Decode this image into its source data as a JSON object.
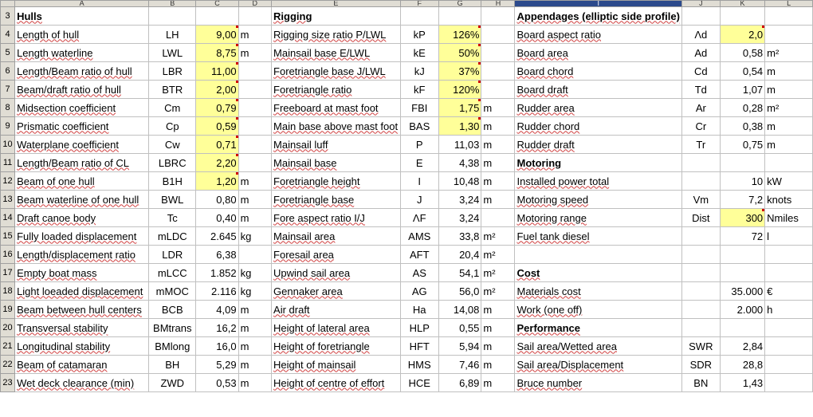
{
  "columns": [
    "A",
    "B",
    "C",
    "D",
    "E",
    "F",
    "G",
    "H",
    "I",
    "J",
    "K",
    "L"
  ],
  "selected_column": "I",
  "rows": [
    {
      "n": "3",
      "a": "Hulls",
      "ab": true,
      "b": "",
      "c": "",
      "cy": false,
      "d": "",
      "e": "Rigging",
      "eb": true,
      "f": "",
      "g": "",
      "gy": false,
      "h": "",
      "i": "Appendages (elliptic side profile)",
      "ib": true,
      "j": "",
      "k": "",
      "ky": false,
      "l": ""
    },
    {
      "n": "4",
      "a": "Length of hull",
      "b": "LH",
      "c": "9,00",
      "cy": true,
      "d": "m",
      "e": "Rigging size ratio P/LWL",
      "f": "kP",
      "g": "126%",
      "gy": true,
      "h": "",
      "i": "Board aspect ratio",
      "j": "Λd",
      "k": "2,0",
      "ky": true,
      "l": ""
    },
    {
      "n": "5",
      "a": "Length waterline",
      "b": "LWL",
      "c": "8,75",
      "cy": true,
      "d": "m",
      "e": "Mainsail base E/LWL",
      "f": "kE",
      "g": "50%",
      "gy": true,
      "h": "",
      "i": "Board area",
      "j": "Ad",
      "k": "0,58",
      "ky": false,
      "l": "m²"
    },
    {
      "n": "6",
      "a": "Length/Beam ratio of hull",
      "b": "LBR",
      "c": "11,00",
      "cy": true,
      "d": "",
      "e": "Foretriangle base J/LWL",
      "f": "kJ",
      "g": "37%",
      "gy": true,
      "h": "",
      "i": "Board chord",
      "j": "Cd",
      "k": "0,54",
      "ky": false,
      "l": "m"
    },
    {
      "n": "7",
      "a": "Beam/draft ratio of hull",
      "b": "BTR",
      "c": "2,00",
      "cy": true,
      "d": "",
      "e": "Foretriangle ratio",
      "f": "kF",
      "g": "120%",
      "gy": true,
      "h": "",
      "i": "Board draft",
      "j": "Td",
      "k": "1,07",
      "ky": false,
      "l": "m"
    },
    {
      "n": "8",
      "a": "Midsection coefficient",
      "b": "Cm",
      "c": "0,79",
      "cy": true,
      "d": "",
      "e": "Freeboard at mast foot",
      "f": "FBI",
      "g": "1,75",
      "gy": true,
      "h": "m",
      "i": "Rudder area",
      "j": "Ar",
      "k": "0,28",
      "ky": false,
      "l": "m²"
    },
    {
      "n": "9",
      "a": "Prismatic coefficient",
      "b": "Cp",
      "c": "0,59",
      "cy": true,
      "d": "",
      "e": "Main base above mast foot",
      "f": "BAS",
      "g": "1,30",
      "gy": true,
      "h": "m",
      "i": "Rudder chord",
      "j": "Cr",
      "k": "0,38",
      "ky": false,
      "l": "m"
    },
    {
      "n": "10",
      "a": "Waterplane coefficient",
      "b": "Cw",
      "c": "0,71",
      "cy": true,
      "d": "",
      "e": "Mainsail luff",
      "f": "P",
      "g": "11,03",
      "gy": false,
      "h": "m",
      "i": "Rudder draft",
      "j": "Tr",
      "k": "0,75",
      "ky": false,
      "l": "m"
    },
    {
      "n": "11",
      "a": "Length/Beam ratio of CL",
      "b": "LBRC",
      "c": "2,20",
      "cy": true,
      "d": "",
      "e": "Mainsail base",
      "f": "E",
      "g": "4,38",
      "gy": false,
      "h": "m",
      "i": "Motoring",
      "ib": true,
      "j": "",
      "k": "",
      "ky": false,
      "l": ""
    },
    {
      "n": "12",
      "a": "Beam of one hull",
      "b": "B1H",
      "c": "1,20",
      "cy": true,
      "d": "m",
      "e": "Foretriangle height",
      "f": "I",
      "g": "10,48",
      "gy": false,
      "h": "m",
      "i": "Installed power total",
      "j": "",
      "k": "10",
      "ky": false,
      "l": "kW"
    },
    {
      "n": "13",
      "a": "Beam waterline of one hull",
      "b": "BWL",
      "c": "0,80",
      "cy": false,
      "d": "m",
      "e": "Foretriangle base",
      "f": "J",
      "g": "3,24",
      "gy": false,
      "h": "m",
      "i": "Motoring speed",
      "j": "Vm",
      "k": "7,2",
      "ky": false,
      "l": "knots"
    },
    {
      "n": "14",
      "a": "Draft canoe body",
      "b": "Tc",
      "c": "0,40",
      "cy": false,
      "d": "m",
      "e": "Fore aspect ratio I/J",
      "f": "ΛF",
      "g": "3,24",
      "gy": false,
      "h": "",
      "i": "Motoring range",
      "j": "Dist",
      "k": "300",
      "ky": true,
      "l": "Nmiles"
    },
    {
      "n": "15",
      "a": "Fully loaded displacement",
      "b": "mLDC",
      "c": "2.645",
      "cy": false,
      "d": "kg",
      "e": "Mainsail area",
      "f": "AMS",
      "g": "33,8",
      "gy": false,
      "h": "m²",
      "i": "Fuel tank diesel",
      "j": "",
      "k": "72",
      "ky": false,
      "l": "l"
    },
    {
      "n": "16",
      "a": "Length/displacement ratio",
      "b": "LDR",
      "c": "6,38",
      "cy": false,
      "d": "",
      "e": "Foresail area",
      "f": "AFT",
      "g": "20,4",
      "gy": false,
      "h": "m²",
      "i": "",
      "j": "",
      "k": "",
      "ky": false,
      "l": ""
    },
    {
      "n": "17",
      "a": "Empty boat mass",
      "b": "mLCC",
      "c": "1.852",
      "cy": false,
      "d": "kg",
      "e": "Upwind sail area",
      "f": "AS",
      "g": "54,1",
      "gy": false,
      "h": "m²",
      "i": "Cost",
      "ib": true,
      "j": "",
      "k": "",
      "ky": false,
      "l": ""
    },
    {
      "n": "18",
      "a": "Light loeaded displacement",
      "b": "mMOC",
      "c": "2.116",
      "cy": false,
      "d": "kg",
      "e": "Gennaker area",
      "f": "AG",
      "g": "56,0",
      "gy": false,
      "h": "m²",
      "i": "Materials cost",
      "j": "",
      "k": "35.000",
      "ky": false,
      "l": "€"
    },
    {
      "n": "19",
      "a": "Beam between hull centers",
      "b": "BCB",
      "c": "4,09",
      "cy": false,
      "d": "m",
      "e": "Air draft",
      "f": "Ha",
      "g": "14,08",
      "gy": false,
      "h": "m",
      "i": "Work (one off)",
      "j": "",
      "k": "2.000",
      "ky": false,
      "l": "h"
    },
    {
      "n": "20",
      "a": "Transversal stability",
      "b": "BMtrans",
      "c": "16,2",
      "cy": false,
      "d": "m",
      "e": "Height of lateral area",
      "f": "HLP",
      "g": "0,55",
      "gy": false,
      "h": "m",
      "i": "Performance",
      "ib": true,
      "j": "",
      "k": "",
      "ky": false,
      "l": ""
    },
    {
      "n": "21",
      "a": "Longitudinal stability",
      "b": "BMlong",
      "c": "16,0",
      "cy": false,
      "d": "m",
      "e": "Height of foretriangle",
      "f": "HFT",
      "g": "5,94",
      "gy": false,
      "h": "m",
      "i": "Sail area/Wetted area",
      "j": "SWR",
      "k": "2,84",
      "ky": false,
      "l": ""
    },
    {
      "n": "22",
      "a": "Beam of catamaran",
      "b": "BH",
      "c": "5,29",
      "cy": false,
      "d": "m",
      "e": "Height of mainsail",
      "f": "HMS",
      "g": "7,46",
      "gy": false,
      "h": "m",
      "i": "Sail area/Displacement",
      "j": "SDR",
      "k": "28,8",
      "ky": false,
      "l": ""
    },
    {
      "n": "23",
      "a": "Wet deck clearance (min)",
      "b": "ZWD",
      "c": "0,53",
      "cy": false,
      "d": "m",
      "e": "Height of centre of effort",
      "f": "HCE",
      "g": "6,89",
      "gy": false,
      "h": "m",
      "i": "Bruce number",
      "j": "BN",
      "k": "1,43",
      "ky": false,
      "l": ""
    }
  ]
}
